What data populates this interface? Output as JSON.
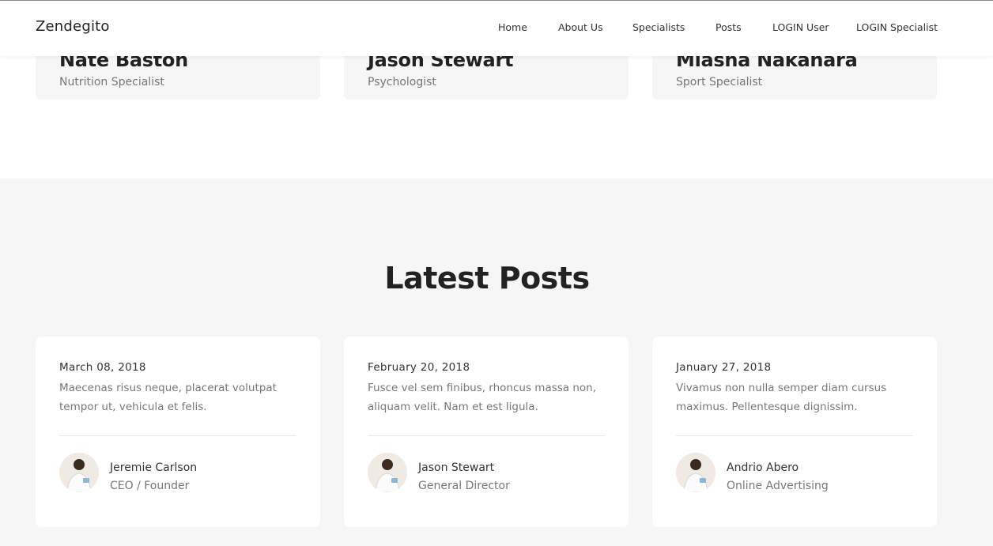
{
  "brand": "Zendegito",
  "nav": {
    "items": [
      {
        "label": "Home"
      },
      {
        "label": "About Us"
      },
      {
        "label": "Specialists"
      },
      {
        "label": "Posts"
      },
      {
        "label": "LOGIN User"
      },
      {
        "label": "LOGIN Specialist"
      }
    ]
  },
  "specialists": [
    {
      "name": "Nate Baston",
      "role": "Nutrition Specialist"
    },
    {
      "name": "Jason Stewart",
      "role": "Psychologist"
    },
    {
      "name": "Miasha Nakahara",
      "role": "Sport Specialist"
    }
  ],
  "posts_section": {
    "title": "Latest Posts",
    "posts": [
      {
        "date": "March 08, 2018",
        "excerpt": "Maecenas risus neque, placerat volutpat tempor ut, vehicula et felis.",
        "author": "Jeremie Carlson",
        "author_role": "CEO / Founder"
      },
      {
        "date": "February 20, 2018",
        "excerpt": "Fusce vel sem finibus, rhoncus massa non, aliquam velit. Nam et est ligula.",
        "author": "Jason Stewart",
        "author_role": "General Director"
      },
      {
        "date": "January 27, 2018",
        "excerpt": "Vivamus non nulla semper diam cursus maximus. Pellentesque dignissim.",
        "author": "Andrio Abero",
        "author_role": "Online Advertising"
      }
    ]
  },
  "colors": {
    "background": "#ffffff",
    "section_background": "#f6f6f6",
    "text_dark": "#222222",
    "text_muted": "#777777"
  }
}
